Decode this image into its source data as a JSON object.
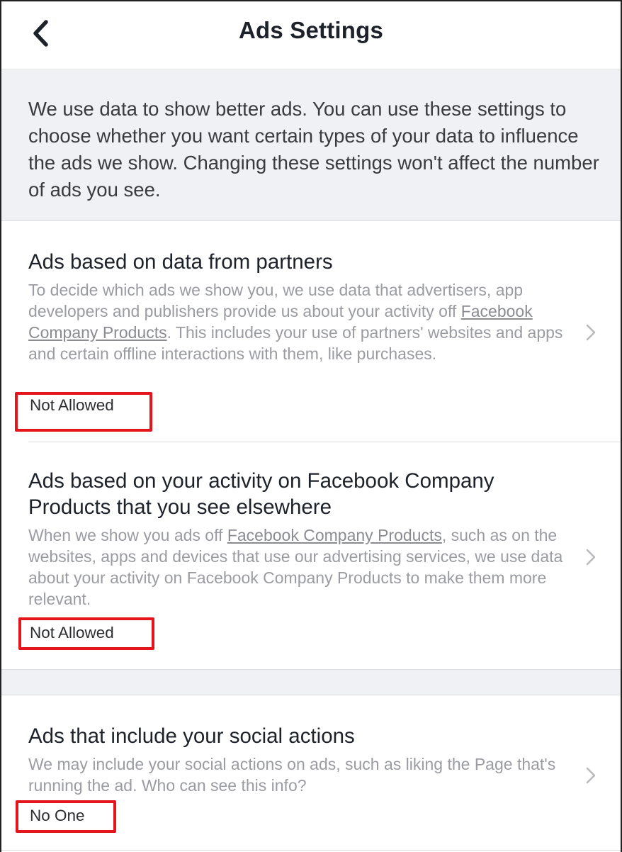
{
  "header": {
    "title": "Ads Settings",
    "back_icon": "chevron-left-icon"
  },
  "intro": {
    "text": "We use data to show better ads. You can use these settings to choose whether you want certain types of your data to influence the ads we show. Changing these settings won't affect the number of ads you see."
  },
  "settings": [
    {
      "title": "Ads based on data from partners",
      "desc_before": "To decide which ads we show you, we use data that advertisers, app developers and publishers provide us about your activity off ",
      "desc_link": "Facebook Company Products",
      "desc_after": ". This includes your use of partners' websites and apps and certain offline interactions with them, like purchases.",
      "status": "Not Allowed"
    },
    {
      "title": "Ads based on your activity on Facebook Company Products that you see elsewhere",
      "desc_before": "When we show you ads off ",
      "desc_link": "Facebook Company Products",
      "desc_after": ", such as on the websites, apps and devices that use our advertising services, we use data about your activity on Facebook Company Products to make them more relevant.",
      "status": "Not Allowed"
    },
    {
      "title": "Ads that include your social actions",
      "desc_before": "We may include your social actions on ads, such as liking the Page that's running the ad. Who can see this info?",
      "desc_link": "",
      "desc_after": "",
      "status": "No One"
    }
  ],
  "colors": {
    "highlight": "#e4161c",
    "section_bg": "#f0f1f5",
    "secondary_text": "#9a9ca1"
  }
}
